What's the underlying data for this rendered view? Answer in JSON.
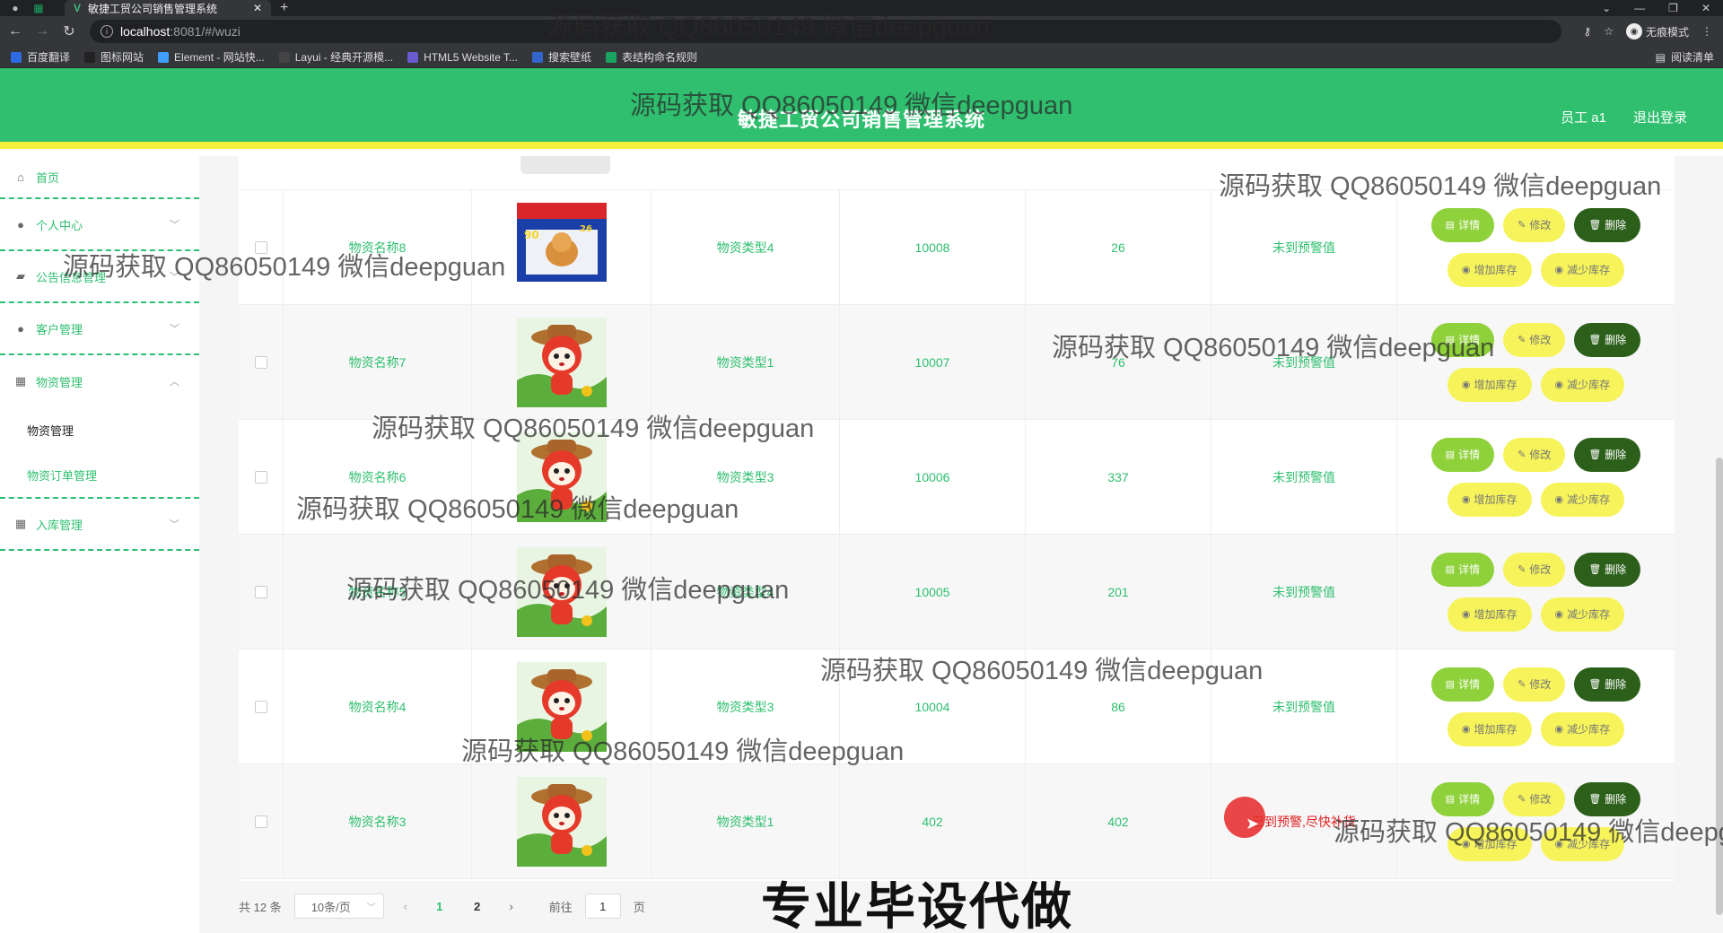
{
  "browser": {
    "tab_title": "敏捷工贸公司销售管理系统",
    "url_host": "localhost",
    "url_path": ":8081/#/wuzi",
    "incognito_label": "无痕模式",
    "reading_list": "阅读清单",
    "bookmarks": [
      {
        "label": "百度翻译",
        "color": "#2d6ae3"
      },
      {
        "label": "图标网站",
        "color": "#222222"
      },
      {
        "label": "Element - 网站快...",
        "color": "#409eff"
      },
      {
        "label": "Layui - 经典开源模...",
        "color": "#444444"
      },
      {
        "label": "HTML5 Website T...",
        "color": "#6a5acd"
      },
      {
        "label": "搜索壁纸",
        "color": "#3366cc"
      },
      {
        "label": "表结构命名规则",
        "color": "#1aa260"
      }
    ]
  },
  "header": {
    "title": "敏捷工贸公司销售管理系统",
    "user": "员工 a1",
    "logout": "退出登录"
  },
  "sidebar": {
    "items": [
      {
        "label": "首页",
        "icon": "home-icon"
      },
      {
        "label": "个人中心",
        "icon": "user-icon"
      },
      {
        "label": "公告信息管理",
        "icon": "megaphone-icon"
      },
      {
        "label": "客户管理",
        "icon": "user-icon"
      },
      {
        "label": "物资管理",
        "icon": "grid-icon"
      },
      {
        "label": "入库管理",
        "icon": "grid-icon"
      }
    ],
    "sub_items": [
      {
        "label": "物资管理"
      },
      {
        "label": "物资订单管理"
      }
    ]
  },
  "buttons": {
    "detail": "详情",
    "edit": "修改",
    "delete": "删除",
    "add_stock": "增加库存",
    "reduce_stock": "减少库存"
  },
  "rows": [
    {
      "name": "物资名称8",
      "type": "物资类型4",
      "code": "10008",
      "qty": "26",
      "warn": "未到预警值",
      "image": "dog"
    },
    {
      "name": "物资名称7",
      "type": "物资类型1",
      "code": "10007",
      "qty": "76",
      "warn": "未到预警值",
      "image": "fox"
    },
    {
      "name": "物资名称6",
      "type": "物资类型3",
      "code": "10006",
      "qty": "337",
      "warn": "未到预警值",
      "image": "fox"
    },
    {
      "name": "物资名称5",
      "type": "物资类型4",
      "code": "10005",
      "qty": "201",
      "warn": "未到预警值",
      "image": "fox"
    },
    {
      "name": "物资名称4",
      "type": "物资类型3",
      "code": "10004",
      "qty": "86",
      "warn": "未到预警值",
      "image": "fox"
    },
    {
      "name": "物资名称3",
      "type": "物资类型1",
      "code": "402",
      "qty": "402",
      "warn": "已到预警,尽快补货",
      "image": "fox"
    }
  ],
  "pagination": {
    "total": "共 12 条",
    "page_size": "10条/页",
    "pages": [
      "1",
      "2"
    ],
    "goto_prefix": "前往",
    "goto_value": "1",
    "goto_suffix": "页"
  },
  "promo": "专业毕设代做",
  "watermark": "源码获取 QQ86050149 微信deepguan"
}
